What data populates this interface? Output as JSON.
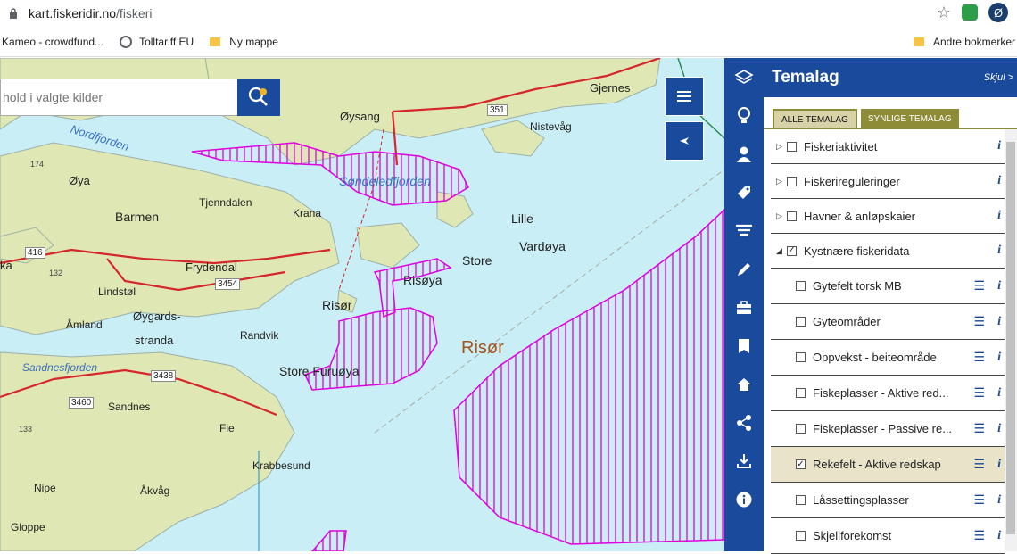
{
  "browser": {
    "url_host": "kart.fiskeridir.no",
    "url_path": "/fiskeri",
    "profile_initial": "Ø",
    "bookmarks": [
      {
        "label": "Kameo - crowdfund..."
      },
      {
        "label": "Tolltariff EU"
      },
      {
        "label": "Ny mappe"
      }
    ],
    "other_bookmarks": "Andre bokmerker"
  },
  "map": {
    "search_placeholder": "hold i valgte kilder",
    "labels": {
      "jernes": "Gjernes",
      "oysang": "Øysang",
      "road351": "351",
      "nistevag": "Nistevåg",
      "nordfjorden": "Nordfjorden",
      "sondeledfjorden": "Søndeledfjorden",
      "n174": "174",
      "oya": "Øya",
      "tjenndalen": "Tjenndalen",
      "barmen": "Barmen",
      "krana": "Krana",
      "lille": "Lille",
      "vardoya": "Vardøya",
      "road416": "416",
      "ka": "ka",
      "frydendal": "Frydendal",
      "n132": "132",
      "store": "Store",
      "risoya": "Risøya",
      "n3454": "3454",
      "lindstol": "Lindstøl",
      "risor_town": "Risør",
      "amland": "Åmland",
      "oygards": "Øygards-",
      "stranda": "stranda",
      "risor_area": "Risør",
      "randvik": "Randvik",
      "sandnesfjorden": "Sandnesfjorden",
      "storefuruoya": "Store Furuøya",
      "n3438": "3438",
      "n3460": "3460",
      "sandnes": "Sandnes",
      "n133": "133",
      "fie": "Fie",
      "krabbesund": "Krabbesund",
      "nipe": "Nipe",
      "akvag": "Åkvåg",
      "gloppe": "Gloppe"
    }
  },
  "panel": {
    "title": "Temalag",
    "hide": "Skjul >",
    "tab_all": "ALLE TEMALAG",
    "tab_visible": "SYNLIGE TEMALAG",
    "groups": [
      {
        "label": "Fiskeriaktivitet",
        "checked": false,
        "expanded": false
      },
      {
        "label": "Fiskerireguleringer",
        "checked": false,
        "expanded": false
      },
      {
        "label": "Havner & anløpskaier",
        "checked": false,
        "expanded": false
      },
      {
        "label": "Kystnære fiskeridata",
        "checked": true,
        "expanded": true
      }
    ],
    "layers": [
      {
        "label": "Gytefelt torsk MB",
        "checked": false
      },
      {
        "label": "Gyteområder",
        "checked": false
      },
      {
        "label": "Oppvekst - beiteområde",
        "checked": false
      },
      {
        "label": "Fiskeplasser - Aktive red...",
        "checked": false
      },
      {
        "label": "Fiskeplasser - Passive re...",
        "checked": false
      },
      {
        "label": "Rekefelt - Aktive redskap",
        "checked": true
      },
      {
        "label": "Låssettingsplasser",
        "checked": false
      },
      {
        "label": "Skjellforekomst",
        "checked": false
      }
    ]
  },
  "icons": {
    "toolbar": [
      "layers-icon",
      "lightbulb-icon",
      "user-icon",
      "tag-icon",
      "fish-icon",
      "pencil-icon",
      "briefcase-icon",
      "bookmark-icon",
      "home-icon",
      "share-icon",
      "download-icon",
      "info-icon"
    ]
  },
  "colors": {
    "primary": "#1a4a9b",
    "hatch": "#e000e0",
    "sea": "#c9eef5",
    "land": "#dfe7b4"
  }
}
